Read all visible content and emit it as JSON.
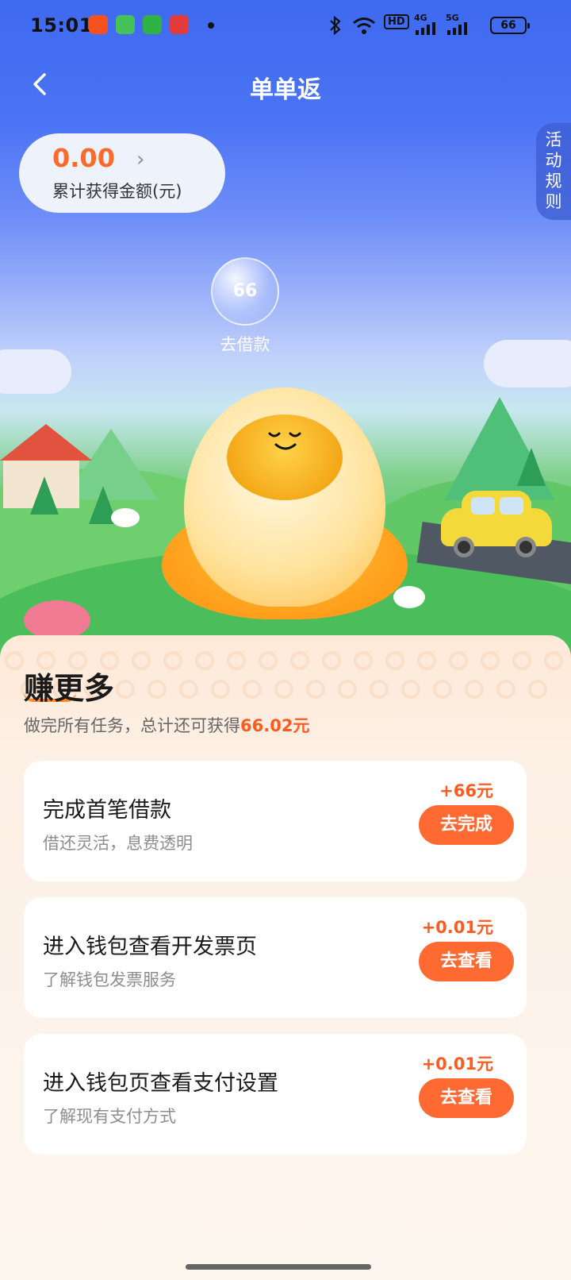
{
  "status_bar": {
    "time": "15:01",
    "network_label": "HD",
    "signal_1": "4G",
    "signal_2": "5G",
    "battery": "66"
  },
  "header": {
    "title": "单单返",
    "back_icon": "chevron-left-icon"
  },
  "summary": {
    "amount": "0.00",
    "amount_label": "累计获得金额(元)"
  },
  "rules_tab": "活动规则",
  "bubble": {
    "value": "66",
    "label": "去借款"
  },
  "earn_more": {
    "title": "赚更多",
    "subtitle_prefix": "做完所有任务，总计还可获得",
    "subtitle_amount": "66.02元"
  },
  "tasks": [
    {
      "title": "完成首笔借款",
      "desc": "借还灵活，息费透明",
      "reward": "+66元",
      "button": "去完成"
    },
    {
      "title": "进入钱包查看开发票页",
      "desc": "了解钱包发票服务",
      "reward": "+0.01元",
      "button": "去查看"
    },
    {
      "title": "进入钱包页查看支付设置",
      "desc": "了解现有支付方式",
      "reward": "+0.01元",
      "button": "去查看"
    }
  ],
  "colors": {
    "accent": "#ff6a33",
    "header_blue": "#3e6af0",
    "reward_orange": "#ff5a1f"
  }
}
